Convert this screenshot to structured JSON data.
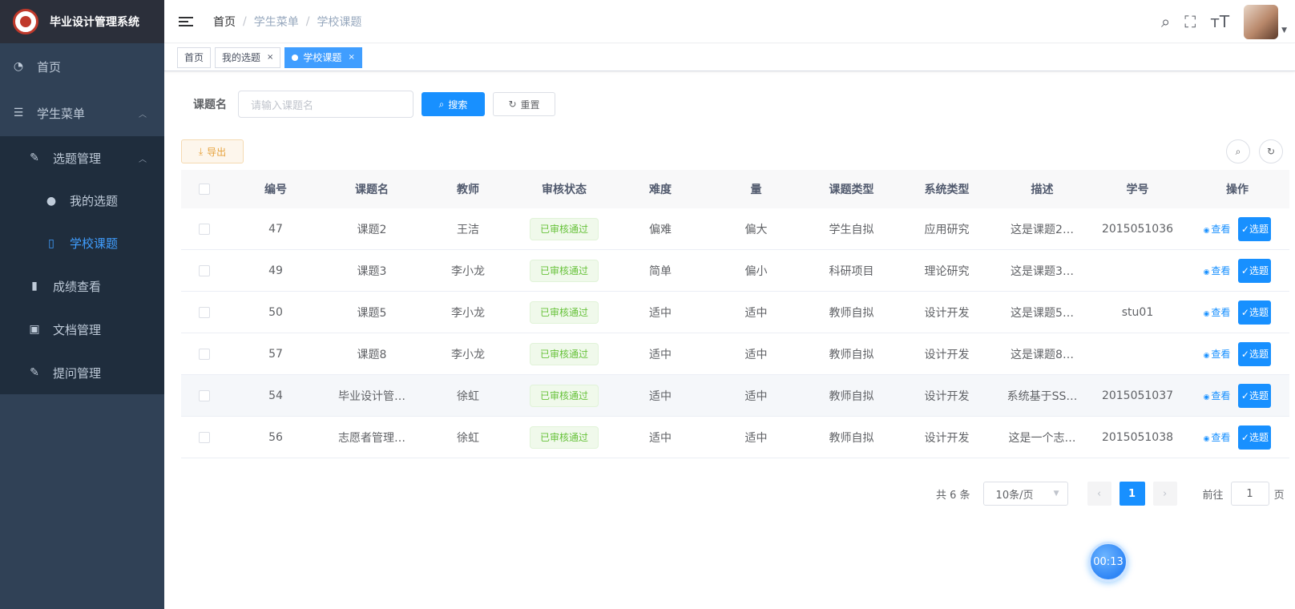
{
  "app": {
    "title": "毕业设计管理系统"
  },
  "sidebar": {
    "home": "首页",
    "student_menu": "学生菜单",
    "topic_mgmt": "选题管理",
    "my_topics": "我的选题",
    "school_topics": "学校课题",
    "grades": "成绩查看",
    "docs": "文档管理",
    "questions": "提问管理"
  },
  "breadcrumb": [
    "首页",
    "学生菜单",
    "学校课题"
  ],
  "tags": [
    {
      "label": "首页"
    },
    {
      "label": "我的选题",
      "close": "×"
    },
    {
      "label": "学校课题",
      "close": "×"
    }
  ],
  "search": {
    "label": "课题名",
    "placeholder": "请输入课题名",
    "search_btn": "搜索",
    "reset_btn": "重置"
  },
  "toolbar": {
    "export": "导出"
  },
  "table": {
    "headers": [
      "编号",
      "课题名",
      "教师",
      "审核状态",
      "难度",
      "量",
      "课题类型",
      "系统类型",
      "描述",
      "学号",
      "操作"
    ],
    "view_label": "查看",
    "pick_label": "选题",
    "rows": [
      {
        "id": "47",
        "name": "课题2",
        "teacher": "王洁",
        "status": "已审核通过",
        "difficulty": "偏难",
        "amount": "偏大",
        "topic_type": "学生自拟",
        "sys_type": "应用研究",
        "desc": "这是课题2…",
        "student_no": "2015051036"
      },
      {
        "id": "49",
        "name": "课题3",
        "teacher": "李小龙",
        "status": "已审核通过",
        "difficulty": "简单",
        "amount": "偏小",
        "topic_type": "科研项目",
        "sys_type": "理论研究",
        "desc": "这是课题3…",
        "student_no": ""
      },
      {
        "id": "50",
        "name": "课题5",
        "teacher": "李小龙",
        "status": "已审核通过",
        "difficulty": "适中",
        "amount": "适中",
        "topic_type": "教师自拟",
        "sys_type": "设计开发",
        "desc": "这是课题5…",
        "student_no": "stu01"
      },
      {
        "id": "57",
        "name": "课题8",
        "teacher": "李小龙",
        "status": "已审核通过",
        "difficulty": "适中",
        "amount": "适中",
        "topic_type": "教师自拟",
        "sys_type": "设计开发",
        "desc": "这是课题8…",
        "student_no": ""
      },
      {
        "id": "54",
        "name": "毕业设计管…",
        "teacher": "徐虹",
        "status": "已审核通过",
        "difficulty": "适中",
        "amount": "适中",
        "topic_type": "教师自拟",
        "sys_type": "设计开发",
        "desc": "系统基于SS…",
        "student_no": "2015051037"
      },
      {
        "id": "56",
        "name": "志愿者管理…",
        "teacher": "徐虹",
        "status": "已审核通过",
        "difficulty": "适中",
        "amount": "适中",
        "topic_type": "教师自拟",
        "sys_type": "设计开发",
        "desc": "这是一个志…",
        "student_no": "2015051038"
      }
    ]
  },
  "pagination": {
    "total": "共 6 条",
    "page_size": "10条/页",
    "current": "1",
    "goto_label": "前往",
    "goto_value": "1",
    "page_suffix": "页"
  },
  "timer": "00:13",
  "colors": {
    "sidebar": "#304156",
    "primary": "#1890ff",
    "success": "#67c23a"
  }
}
